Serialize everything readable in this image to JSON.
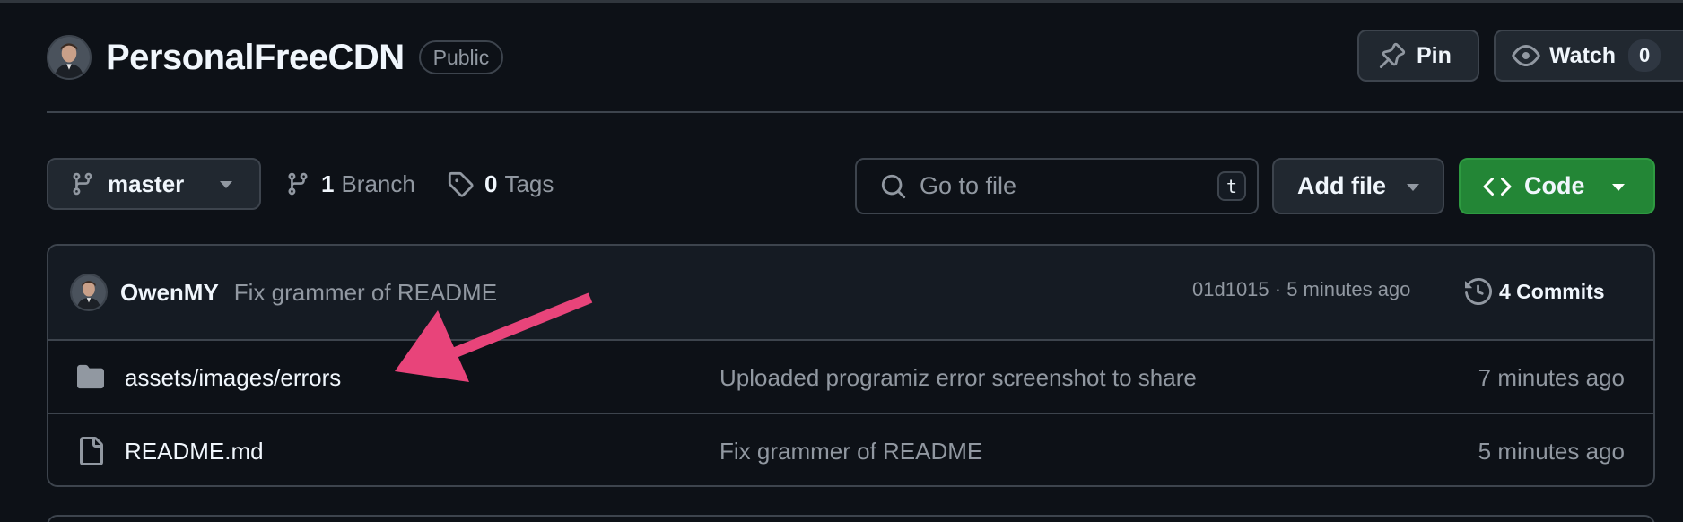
{
  "repo": {
    "name": "PersonalFreeCDN",
    "visibility": "Public",
    "owner_avatar_icon": "user-avatar"
  },
  "header_actions": {
    "pin_label": "Pin",
    "watch_label": "Watch",
    "watch_count": "0"
  },
  "toolbar": {
    "branch_name": "master",
    "branches_count": "1",
    "branches_label": "Branch",
    "tags_count": "0",
    "tags_label": "Tags",
    "search_placeholder": "Go to file",
    "search_shortcut": "t",
    "add_file_label": "Add file",
    "code_label": "Code"
  },
  "latest_commit": {
    "author": "OwenMY",
    "message": "Fix grammer of README",
    "meta": "01d1015 · 5 minutes ago",
    "commits_label": "4 Commits"
  },
  "files": [
    {
      "type": "folder",
      "icon": "folder-icon",
      "name": "assets/images/errors",
      "commit_message": "Uploaded programiz error screenshot to share",
      "age": "7 minutes ago"
    },
    {
      "type": "file",
      "icon": "file-icon",
      "name": "README.md",
      "commit_message": "Fix grammer of README",
      "age": "5 minutes ago"
    }
  ],
  "colors": {
    "background": "#0d1117",
    "border": "#3d444d",
    "code_button": "#238636",
    "annotation_arrow": "#e8447a"
  }
}
